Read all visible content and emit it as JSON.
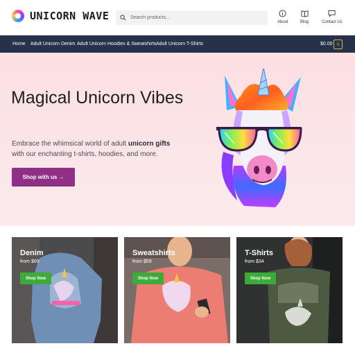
{
  "brand": {
    "name": "UNICORN WAVE",
    "icon": "unicorn-wave-logo"
  },
  "search": {
    "placeholder": "Search products...",
    "value": ""
  },
  "header_links": [
    {
      "label": "About",
      "icon": "info-icon"
    },
    {
      "label": "Blog",
      "icon": "book-icon"
    },
    {
      "label": "Contact Us",
      "icon": "chat-icon"
    }
  ],
  "nav": {
    "items": [
      {
        "label": "Home"
      },
      {
        "label": "Adult Unicorn Denim"
      },
      {
        "label": "Adult Unicorn Hoodies & Sweatshirts"
      },
      {
        "label": "Adult Unicorn T-Shirts"
      }
    ],
    "cart_total": "$0.00",
    "cart_count": "0"
  },
  "hero": {
    "title": "Magical Unicorn Vibes",
    "text_before": "Embrace the whimsical world of adult ",
    "text_bold": "unicorn gifts",
    "text_after": " with our enchanting t-shirts, hoodies, and more.",
    "button": "Shop with us →"
  },
  "categories": [
    {
      "title": "Denim",
      "price": "from $69",
      "button": "Shop Now"
    },
    {
      "title": "Sweatshirts",
      "price": "from $59",
      "button": "Shop Now"
    },
    {
      "title": "T-Shirts",
      "price": "from $34",
      "button": "Shop Now"
    }
  ],
  "colors": {
    "nav_bg": "#25324a",
    "hero_button": "#8f2f86",
    "shop_now": "#3cab3a",
    "cart_accent": "#d8b04a"
  }
}
